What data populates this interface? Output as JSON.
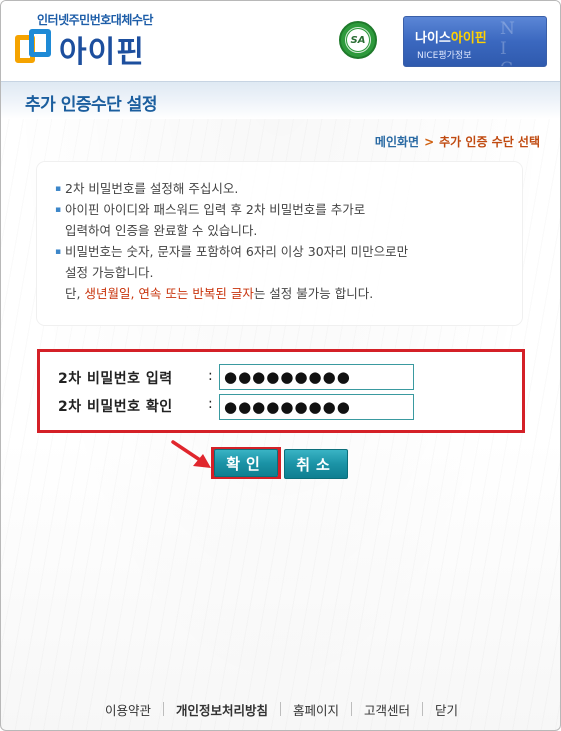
{
  "header": {
    "logo_sub": "인터넷주민번호대체수단",
    "logo_text": "아이핀",
    "seal_text": "SA",
    "nice_title_prefix": "나이스",
    "nice_title_accent": "아이핀",
    "nice_sub": "NICE평가정보"
  },
  "page_title": "추가 인증수단 설정",
  "breadcrumb": {
    "home": "메인화면",
    "separator": ">",
    "current": "추가 인증 수단 선택"
  },
  "info": {
    "bullet": "▪",
    "line1": "2차 비밀번호를 설정해 주십시오.",
    "line2a": "아이핀 아이디와 패스워드 입력 후 2차 비밀번호를 추가로",
    "line2b": "입력하여 인증을 완료할 수 있습니다.",
    "line3a": "비밀번호는 숫자, 문자를 포함하여 6자리 이상 30자리 미만으로만",
    "line3b": "설정 가능합니다.",
    "line4_prefix": "단, ",
    "line4_red": "생년월일, 연속 또는 반복된 글자",
    "line4_suffix": "는 설정 불가능 합니다."
  },
  "form": {
    "pw_label": "2차 비밀번호 입력",
    "pw_confirm_label": "2차 비밀번호 확인",
    "colon": ":",
    "pw_value": "●●●●●●●●●",
    "pw_confirm_value": "●●●●●●●●●"
  },
  "buttons": {
    "ok": "확인",
    "cancel": "취소"
  },
  "footer": {
    "terms": "이용약관",
    "privacy": "개인정보처리방침",
    "home": "홈페이지",
    "support": "고객센터",
    "close": "닫기"
  },
  "colors": {
    "brand_blue": "#1d4f9e",
    "highlight_red": "#d42027",
    "button_teal": "#1b93a6",
    "warning_red": "#c8340d"
  }
}
